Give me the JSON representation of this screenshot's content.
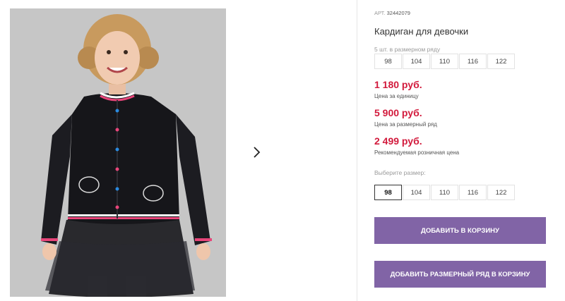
{
  "product": {
    "sku_label": "АРТ.",
    "sku_value": "32442079",
    "title": "Кардиган для девочки",
    "image_alt": "Кардиган для девочки — фото"
  },
  "pack": {
    "caption": "5 шт. в размерном ряду",
    "sizes": [
      "98",
      "104",
      "110",
      "116",
      "122"
    ]
  },
  "prices": [
    {
      "value": "1 180 руб.",
      "label": "Цена за единицу"
    },
    {
      "value": "5 900 руб.",
      "label": "Цена за размерный ряд"
    },
    {
      "value": "2 499 руб.",
      "label": "Рекомендуемая розничная цена"
    }
  ],
  "size_picker": {
    "caption": "Выберите размер:",
    "sizes": [
      "98",
      "104",
      "110",
      "116",
      "122"
    ],
    "selected": "98"
  },
  "buttons": {
    "add_to_cart": "ДОБАВИТЬ В КОРЗИНУ",
    "add_pack_to_cart": "ДОБАВИТЬ РАЗМЕРНЫЙ РЯД В КОРЗИНУ"
  },
  "colors": {
    "price": "#d21a3c",
    "button": "#8164a6"
  },
  "icons": {
    "next": "chevron-right-icon"
  }
}
